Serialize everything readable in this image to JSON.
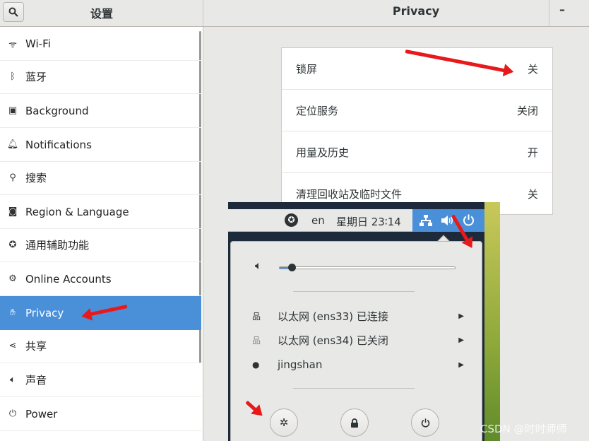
{
  "header": {
    "search_icon": "search-icon",
    "left_title": "设置",
    "title": "Privacy",
    "minimize_label": "–"
  },
  "sidebar": {
    "items": [
      {
        "icon": "wifi-icon",
        "glyph": "ᯤ",
        "label": "Wi-Fi"
      },
      {
        "icon": "bluetooth-icon",
        "glyph": "ᛒ",
        "label": "蓝牙"
      },
      {
        "icon": "background-icon",
        "glyph": "▣",
        "label": "Background"
      },
      {
        "icon": "bell-icon",
        "glyph": "🔔︎",
        "label": "Notifications"
      },
      {
        "icon": "search-icon",
        "glyph": "⚲",
        "label": "搜索"
      },
      {
        "icon": "camera-icon",
        "glyph": "◙",
        "label": "Region & Language"
      },
      {
        "icon": "accessibility-icon",
        "glyph": "✪",
        "label": "通用辅助功能"
      },
      {
        "icon": "online-accounts-icon",
        "glyph": "⚙",
        "label": "Online Accounts"
      },
      {
        "icon": "hand-icon",
        "glyph": "✋︎",
        "label": "Privacy"
      },
      {
        "icon": "share-icon",
        "glyph": "⋖",
        "label": "共享"
      },
      {
        "icon": "speaker-icon",
        "glyph": "🔈︎",
        "label": "声音"
      },
      {
        "icon": "power-icon",
        "glyph": "⏻",
        "label": "Power"
      }
    ]
  },
  "privacy": {
    "rows": [
      {
        "label": "锁屏",
        "value": "关"
      },
      {
        "label": "定位服务",
        "value": "关闭"
      },
      {
        "label": "用量及历史",
        "value": "开"
      },
      {
        "label": "清理回收站及临时文件",
        "value": "关"
      }
    ]
  },
  "topbar": {
    "lang": "en",
    "clock": "星期日 23∶14",
    "a11y_icon": "accessibility-icon"
  },
  "system_menu": {
    "volume_fraction": 0.07,
    "rows": [
      {
        "icon": "network-wired-icon",
        "glyph": "品",
        "label": "以太网 (ens33) 已连接"
      },
      {
        "icon": "network-wired-off-icon",
        "glyph": "品",
        "label": "以太网 (ens34) 已关闭"
      },
      {
        "icon": "user-icon",
        "glyph": "●",
        "label": "jingshan"
      }
    ],
    "buttons": [
      "settings-icon",
      "lock-icon",
      "power-icon"
    ]
  },
  "watermark": "CSDN @时时师师",
  "colors": {
    "accent": "#4a90d9",
    "annotation": "#e8191b"
  }
}
